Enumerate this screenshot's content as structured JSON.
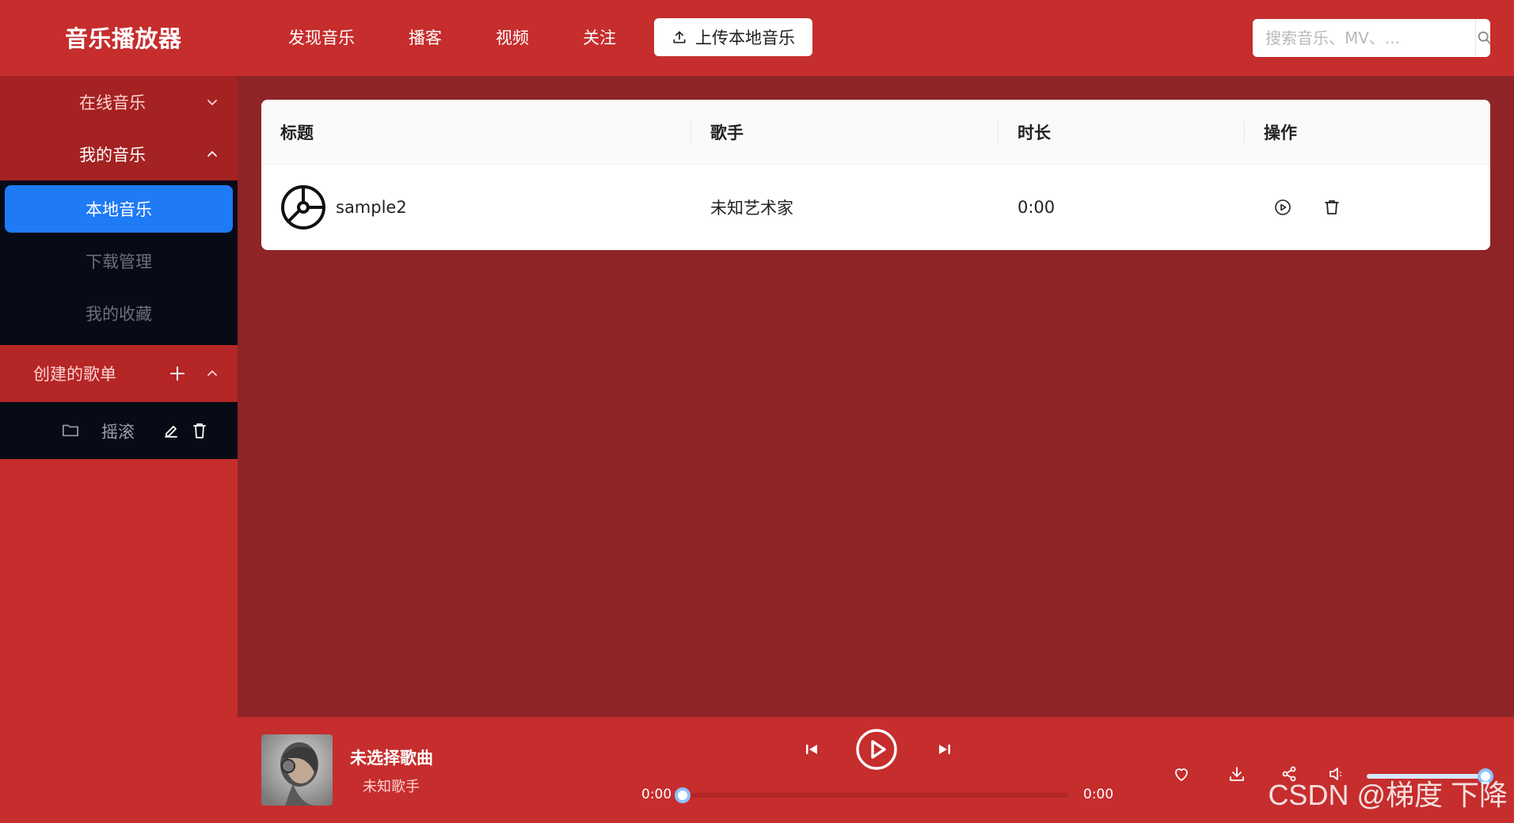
{
  "app": {
    "title": "音乐播放器"
  },
  "nav": {
    "items": [
      {
        "label": "发现音乐"
      },
      {
        "label": "播客"
      },
      {
        "label": "视频"
      },
      {
        "label": "关注"
      }
    ],
    "upload_label": "上传本地音乐"
  },
  "search": {
    "placeholder": "搜索音乐、MV、...",
    "value": ""
  },
  "sidebar": {
    "online_music_label": "在线音乐",
    "my_music_label": "我的音乐",
    "my_music_items": [
      {
        "label": "本地音乐",
        "active": true
      },
      {
        "label": "下载管理",
        "active": false
      },
      {
        "label": "我的收藏",
        "active": false
      }
    ],
    "created_playlists_label": "创建的歌单",
    "playlists": [
      {
        "name": "摇滚"
      }
    ]
  },
  "table": {
    "headers": {
      "title": "标题",
      "artist": "歌手",
      "duration": "时长",
      "actions": "操作"
    },
    "rows": [
      {
        "title": "sample2",
        "artist": "未知艺术家",
        "duration": "0:00"
      }
    ]
  },
  "player": {
    "song_title": "未选择歌曲",
    "song_artist": "未知歌手",
    "current_time": "0:00",
    "total_time": "0:00",
    "progress": 0.0,
    "volume": 1.0
  },
  "watermark": "CSDN @梯度 下降",
  "colors": {
    "primary_red": "#c62d2d",
    "main_bg": "#8e2427",
    "active_blue": "#1f7af6",
    "submenu_bg": "#070b16"
  }
}
